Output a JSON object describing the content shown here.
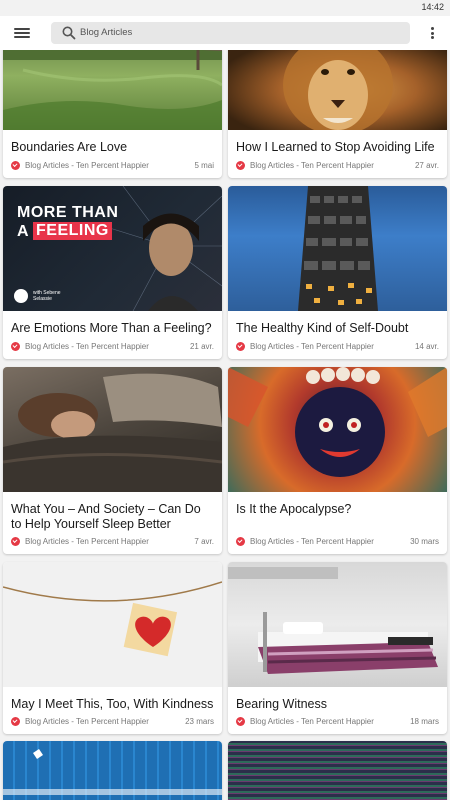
{
  "status_bar": {
    "time": "14:42"
  },
  "app_bar": {
    "search_text": "Blog Articles"
  },
  "cards": [
    {
      "title": "Boundaries Are Love",
      "source": "Blog Articles - Ten Percent Happier",
      "date": "5 mai",
      "image": "grass-field"
    },
    {
      "title": "How I Learned to Stop Avoiding Life",
      "source": "Blog Articles - Ten Percent Happier",
      "date": "27 avr.",
      "image": "lion"
    },
    {
      "title": "Are Emotions More Than a Feeling?",
      "source": "Blog Articles - Ten Percent Happier",
      "date": "21 avr.",
      "image": "more-than-a-feeling",
      "image_text_line1": "MORE THAN",
      "image_text_a": "A",
      "image_text_feeling": "FEELING",
      "image_small_text": "with Sebene Selassie"
    },
    {
      "title": "The Healthy Kind of Self-Doubt",
      "source": "Blog Articles - Ten Percent Happier",
      "date": "14 avr.",
      "image": "tv-tower"
    },
    {
      "title": "What You – And Society – Can Do to Help Yourself Sleep Better",
      "source": "Blog Articles - Ten Percent Happier",
      "date": "7 avr.",
      "image": "sleeping-person"
    },
    {
      "title": "Is It the Apocalypse?",
      "source": "Blog Articles - Ten Percent Happier",
      "date": "30 mars",
      "image": "tibetan-deity"
    },
    {
      "title": "May I Meet This, Too, With Kindness",
      "source": "Blog Articles - Ten Percent Happier",
      "date": "23 mars",
      "image": "paper-heart"
    },
    {
      "title": "Bearing Witness",
      "source": "Blog Articles - Ten Percent Happier",
      "date": "18 mars",
      "image": "hospital-bed"
    },
    {
      "title": "",
      "source": "",
      "date": "",
      "image": "blue-fence"
    },
    {
      "title": "",
      "source": "",
      "date": "",
      "image": "glitch"
    }
  ],
  "colors": {
    "source_icon": "#e53945",
    "app_bar": "#ffffff",
    "background": "#f2f2f2"
  }
}
